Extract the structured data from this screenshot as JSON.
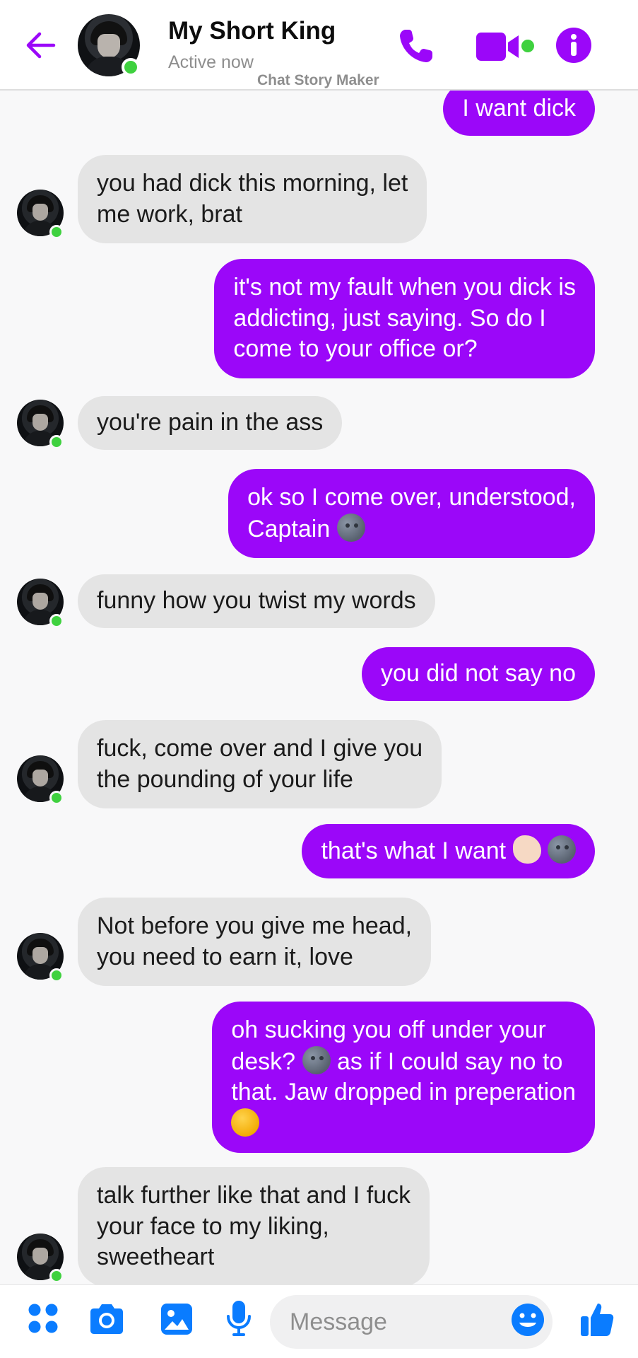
{
  "header": {
    "contact_name": "My Short King",
    "status": "Active now",
    "watermark": "Chat Story Maker",
    "icons": [
      "back-arrow-icon",
      "phone-icon",
      "video-camera-icon",
      "info-icon"
    ],
    "accent_color": "#9b07f9",
    "online_color": "#3fd13f"
  },
  "messages": [
    {
      "side": "out",
      "lines": [
        "I want dick"
      ]
    },
    {
      "side": "in",
      "lines": [
        "you had dick this morning, let",
        "me work, brat"
      ]
    },
    {
      "side": "out",
      "lines": [
        "it's not my fault when you dick is",
        "addicting, just saying. So do I",
        "come to your office or?"
      ]
    },
    {
      "side": "in",
      "lines": [
        "you're pain in the ass"
      ]
    },
    {
      "side": "out",
      "lines": [
        "ok so I come over, understood,",
        "Captain"
      ],
      "emoji": "moon-face"
    },
    {
      "side": "in",
      "lines": [
        "funny how you twist my words"
      ]
    },
    {
      "side": "out",
      "lines": [
        "you did not say no"
      ]
    },
    {
      "side": "in",
      "lines": [
        "fuck, come over and I give you",
        "the pounding of your life"
      ]
    },
    {
      "side": "out",
      "lines": [
        "that's what I want"
      ],
      "emoji": "pinch-hand moon-face"
    },
    {
      "side": "in",
      "lines": [
        "Not before you give me head,",
        "you need to earn it, love"
      ]
    },
    {
      "side": "out",
      "lines": [
        "oh sucking you off under your",
        "desk?",
        "as if I could say no to",
        "that. Jaw dropped in preperation"
      ],
      "emoji": "moon-face smirk-face"
    },
    {
      "side": "in",
      "lines": [
        "talk further like that and I fuck",
        "your face to my liking,",
        "sweetheart"
      ]
    }
  ],
  "composer": {
    "placeholder": "Message",
    "icons": [
      "apps-grid-icon",
      "camera-icon",
      "gallery-icon",
      "microphone-icon",
      "emoji-smile-icon",
      "thumbs-up-icon"
    ]
  },
  "colors": {
    "outgoing_bubble": "#9b07f9",
    "incoming_bubble": "#e4e4e4",
    "background": "#f8f8f9"
  }
}
